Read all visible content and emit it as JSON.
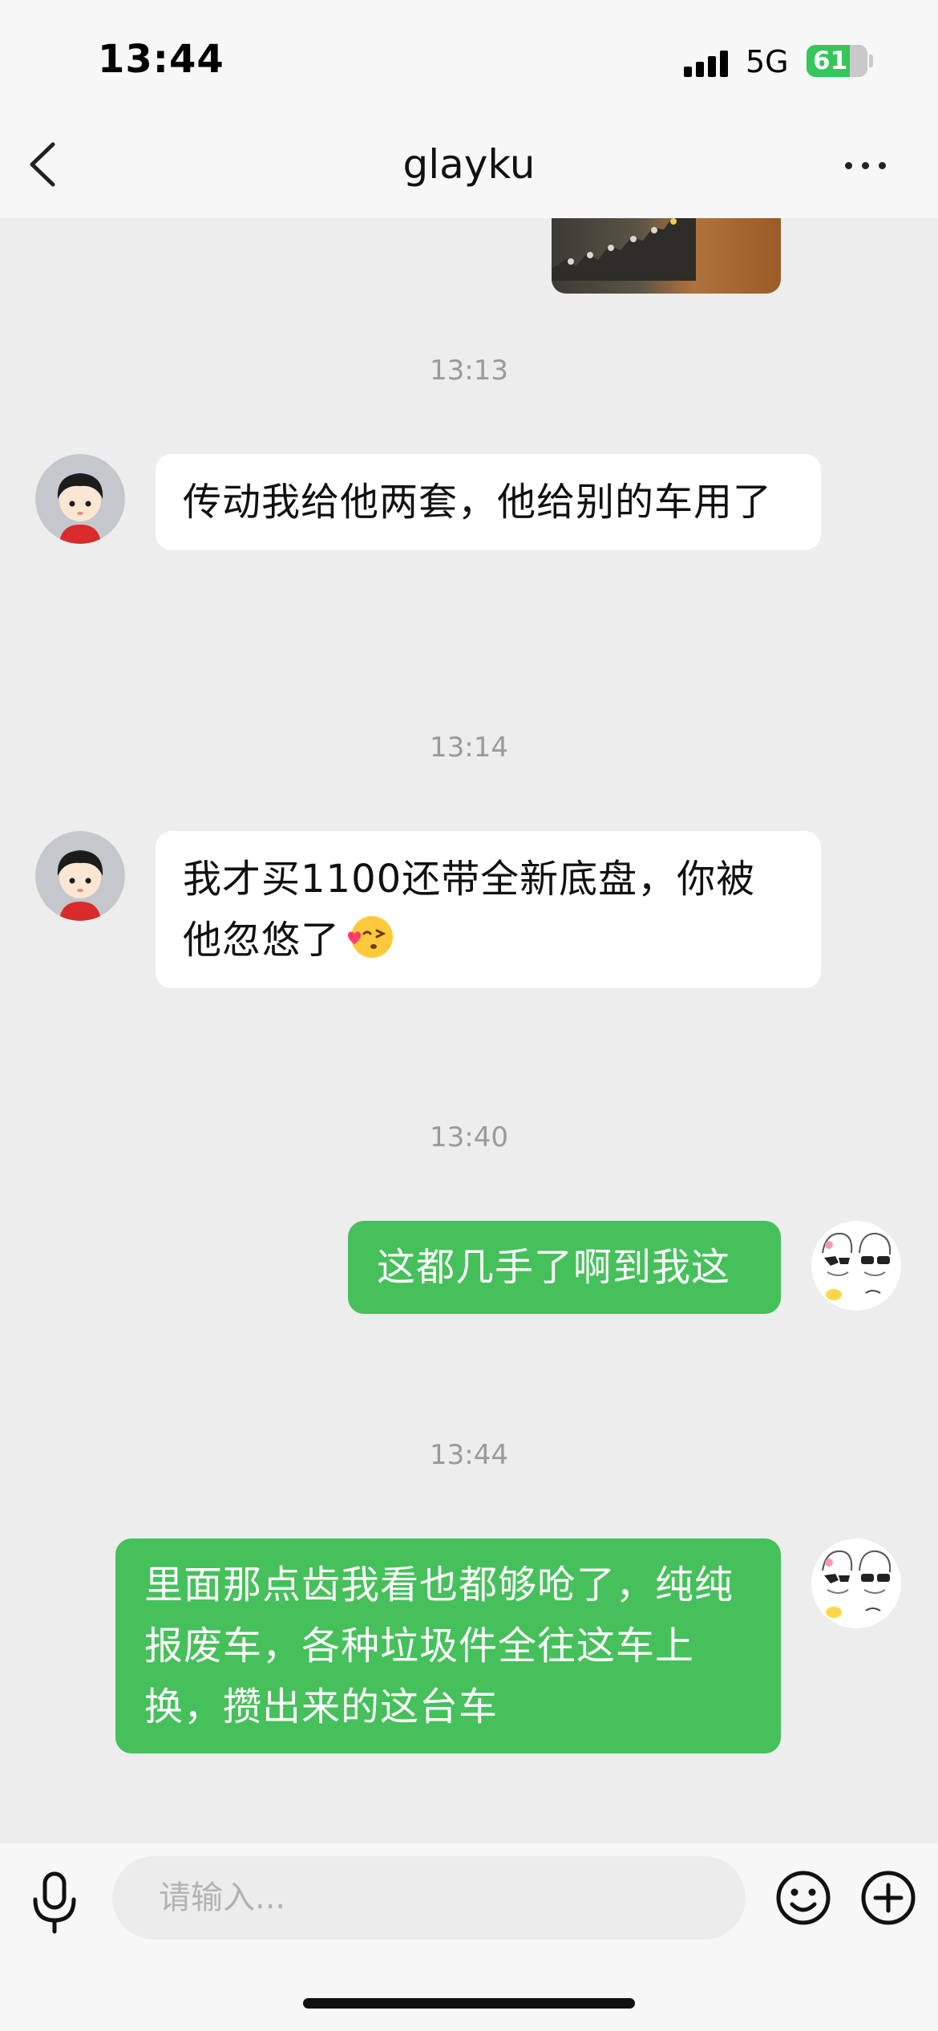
{
  "status_bar": {
    "time": "13:44",
    "network": "5G",
    "battery": "61"
  },
  "header": {
    "title": "glayku"
  },
  "messages": [
    {
      "timestamp": "13:13",
      "direction": "incoming",
      "text": "传动我给他两套，他给别的车用了"
    },
    {
      "timestamp": "13:14",
      "direction": "incoming",
      "text": "我才买1100还带全新底盘，你被他忽悠了",
      "emoji": "blowing-kiss-emoji"
    },
    {
      "timestamp": "13:40",
      "direction": "outgoing",
      "text": "这都几手了啊到我这"
    },
    {
      "timestamp": "13:44",
      "direction": "outgoing",
      "text": "里面那点齿我看也都够呛了，纯纯报废车，各种垃圾件全往这车上换，攒出来的这台车"
    }
  ],
  "input_bar": {
    "placeholder": "请输入..."
  },
  "colors": {
    "outgoing_bubble": "#45c05a",
    "incoming_bubble": "#ffffff",
    "chat_background": "#ededed",
    "battery": "#34c759"
  },
  "icons": [
    "back-chevron-icon",
    "more-dots-icon",
    "microphone-icon",
    "emoji-face-icon",
    "plus-circle-icon"
  ]
}
